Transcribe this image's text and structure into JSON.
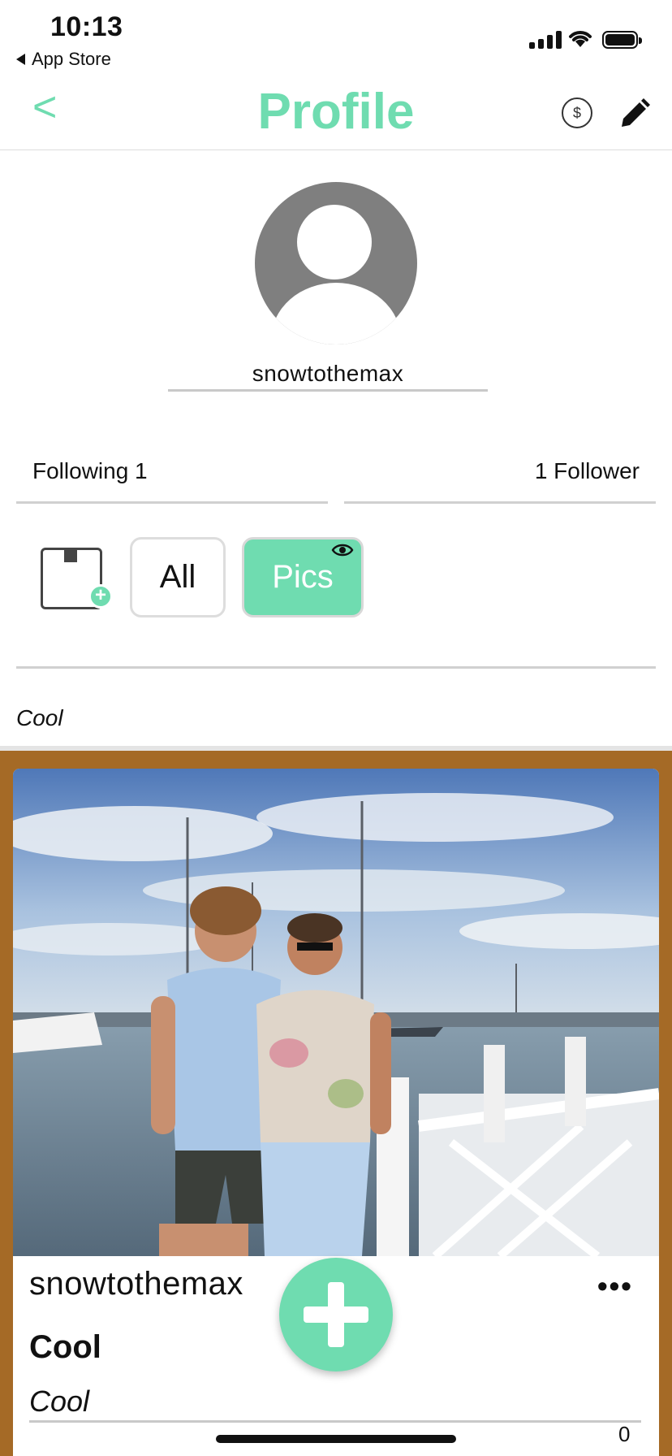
{
  "status_bar": {
    "time": "10:13",
    "back_app": "App Store"
  },
  "header": {
    "back_label": "<",
    "title": "Profile",
    "coin_symbol": "$"
  },
  "profile": {
    "username": "snowtothemax",
    "following_label": "Following 1",
    "followers_label": "1 Follower",
    "bio": "Cool"
  },
  "filters": {
    "items": [
      {
        "label": "All",
        "active": false
      },
      {
        "label": "Pics",
        "active": true
      }
    ]
  },
  "post": {
    "username": "snowtothemax",
    "more": "•••",
    "title": "Cool",
    "caption": "Cool",
    "count": "0"
  },
  "colors": {
    "accent": "#6fdcb0",
    "post_background": "#a56a26"
  }
}
